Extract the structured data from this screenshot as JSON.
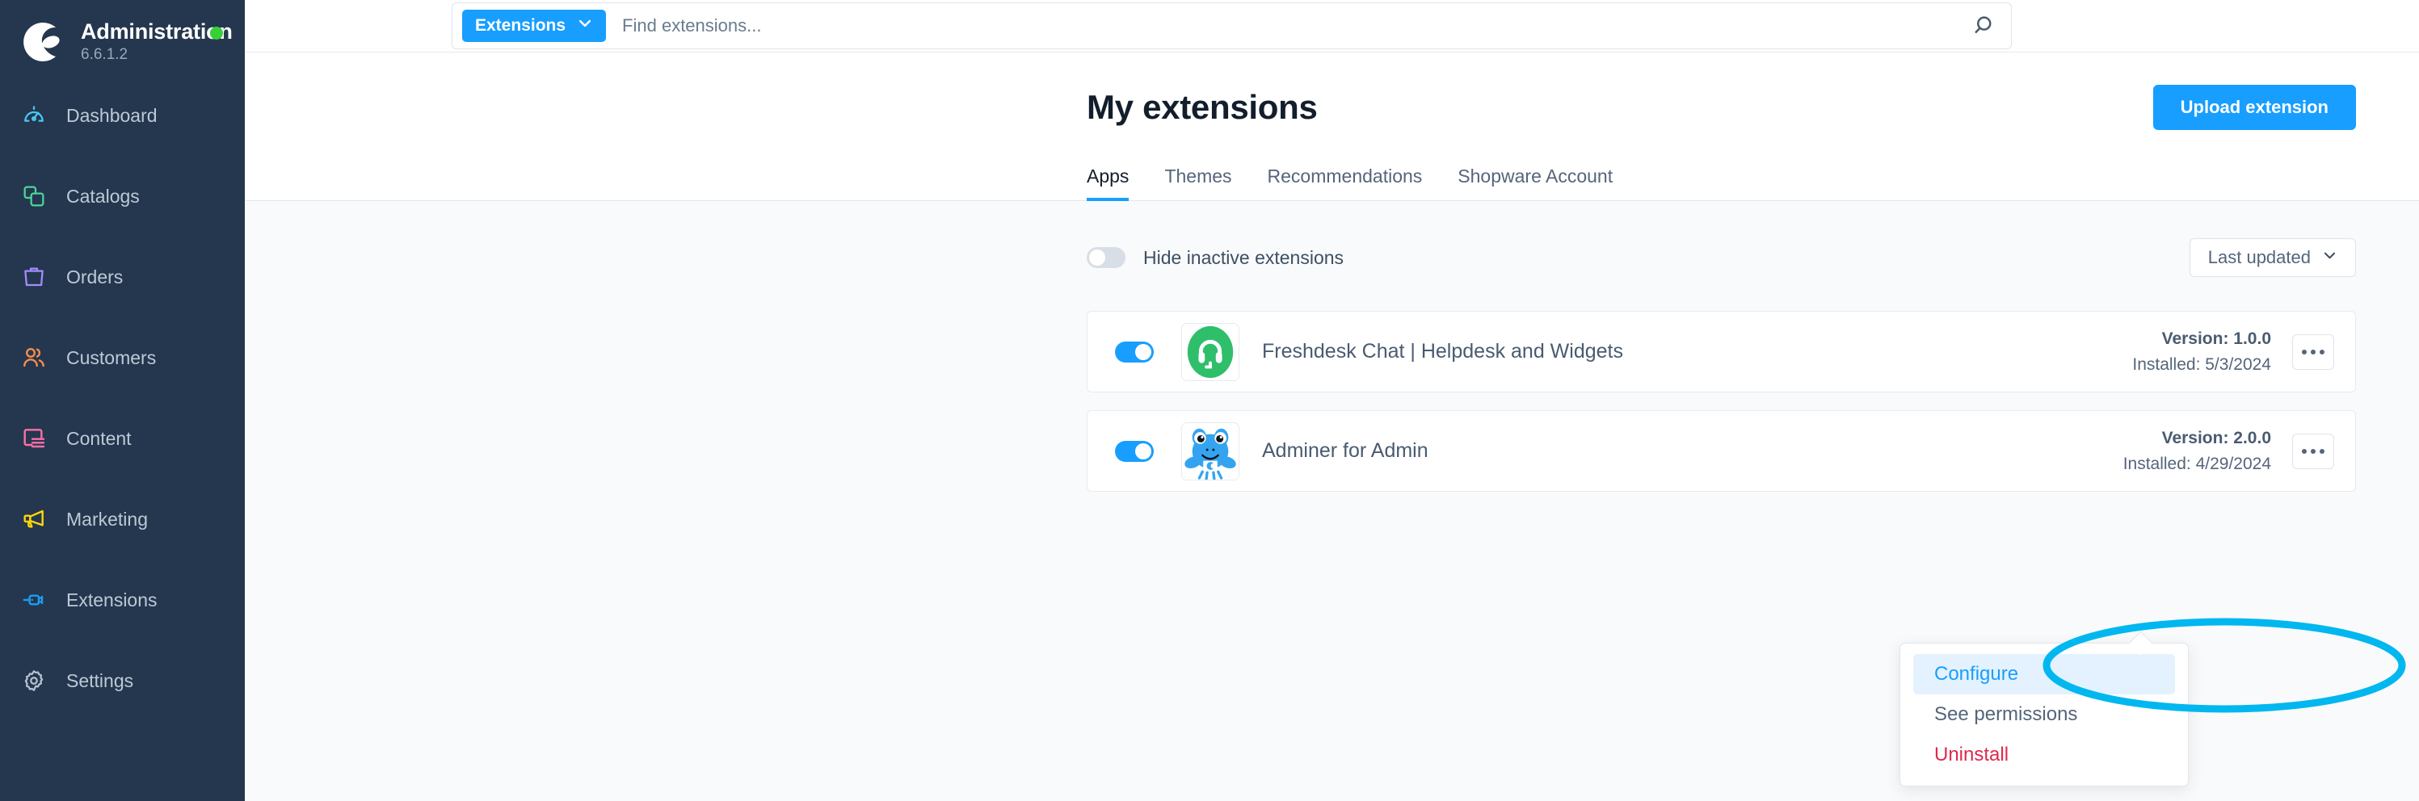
{
  "sidebar": {
    "brand": {
      "title": "Administration",
      "version": "6.6.1.2",
      "status": "online"
    },
    "items": [
      {
        "label": "Dashboard",
        "icon": "gauge-icon",
        "color": "#49c8f5"
      },
      {
        "label": "Catalogs",
        "icon": "copy-icon",
        "color": "#4dd599"
      },
      {
        "label": "Orders",
        "icon": "bag-icon",
        "color": "#a58bff"
      },
      {
        "label": "Customers",
        "icon": "users-icon",
        "color": "#f88b4c"
      },
      {
        "label": "Content",
        "icon": "content-icon",
        "color": "#ff6ea9"
      },
      {
        "label": "Marketing",
        "icon": "megaphone-icon",
        "color": "#ffd60a"
      },
      {
        "label": "Extensions",
        "icon": "plug-icon",
        "color": "#1e9cf5"
      },
      {
        "label": "Settings",
        "icon": "gear-icon",
        "color": "#b6c2cf"
      }
    ]
  },
  "topbar": {
    "scope_label": "Extensions",
    "search_placeholder": "Find extensions...",
    "search_value": ""
  },
  "page": {
    "title": "My extensions",
    "upload_label": "Upload extension",
    "tabs": [
      {
        "label": "Apps",
        "active": true
      },
      {
        "label": "Themes",
        "active": false
      },
      {
        "label": "Recommendations",
        "active": false
      },
      {
        "label": "Shopware Account",
        "active": false
      }
    ]
  },
  "controls": {
    "hide_inactive_label": "Hide inactive extensions",
    "hide_inactive_on": false,
    "sort_label": "Last updated"
  },
  "extensions": [
    {
      "name": "Freshdesk Chat | Helpdesk and Widgets",
      "version_label": "Version: 1.0.0",
      "installed_label": "Installed: 5/3/2024",
      "active": true,
      "icon": "freshdesk-headset-logo"
    },
    {
      "name": "Adminer for Admin",
      "version_label": "Version: 2.0.0",
      "installed_label": "Installed: 4/29/2024",
      "active": true,
      "icon": "adminer-frog-logo"
    }
  ],
  "context_menu": {
    "items": [
      {
        "label": "Configure",
        "state": "highlighted"
      },
      {
        "label": "See permissions",
        "state": "normal"
      },
      {
        "label": "Uninstall",
        "state": "danger"
      }
    ]
  },
  "colors": {
    "accent": "#189eff",
    "sidebar_bg": "#24374e",
    "danger": "#de294c",
    "status_online": "#37d039",
    "annotation": "#00b7ef"
  }
}
